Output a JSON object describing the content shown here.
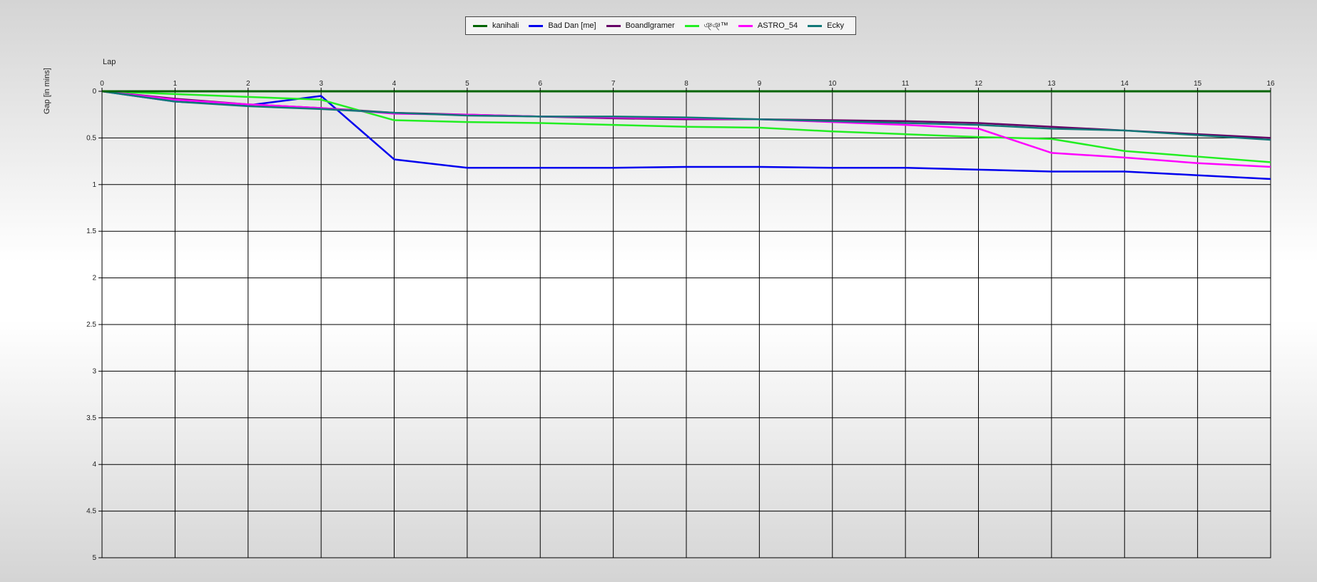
{
  "chart_data": {
    "type": "line",
    "xlabel": "Lap",
    "ylabel": "Gap [in mins]",
    "xlim": [
      0,
      16
    ],
    "ylim": [
      0,
      5
    ],
    "y_inverted": true,
    "grid": true,
    "legend": "top-center",
    "x_ticks": [
      "0",
      "1",
      "2",
      "3",
      "4",
      "5",
      "6",
      "7",
      "8",
      "9",
      "10",
      "11",
      "12",
      "13",
      "14",
      "15",
      "16"
    ],
    "y_ticks": [
      {
        "value": 0,
        "label": "0"
      },
      {
        "value": 0.5,
        "label": "0.5"
      },
      {
        "value": 1,
        "label": "1"
      },
      {
        "value": 1.5,
        "label": "1.5"
      },
      {
        "value": 2,
        "label": "2"
      },
      {
        "value": 2.5,
        "label": "2.5"
      },
      {
        "value": 3,
        "label": "3"
      },
      {
        "value": 3.5,
        "label": "3.5"
      },
      {
        "value": 4,
        "label": "4"
      },
      {
        "value": 4.5,
        "label": "4.5"
      },
      {
        "value": 5,
        "label": "5"
      }
    ],
    "x": [
      0,
      1,
      2,
      3,
      4,
      5,
      6,
      7,
      8,
      9,
      10,
      11,
      12,
      13,
      14,
      15,
      16
    ],
    "series": [
      {
        "name": "kanihali",
        "color": "#006400",
        "values": [
          0,
          0,
          0,
          0,
          0,
          0,
          0,
          0,
          0,
          0,
          0,
          0,
          0,
          0,
          0,
          0,
          0
        ]
      },
      {
        "name": "Bad Dan [me]",
        "color": "#0000ee",
        "values": [
          0,
          0.11,
          0.15,
          0.05,
          0.73,
          0.82,
          0.82,
          0.82,
          0.81,
          0.81,
          0.82,
          0.82,
          0.84,
          0.86,
          0.86,
          0.9,
          0.94
        ]
      },
      {
        "name": "Boandlgramer",
        "color": "#660066",
        "values": [
          0,
          0.08,
          0.14,
          0.18,
          0.23,
          0.25,
          0.27,
          0.29,
          0.3,
          0.3,
          0.31,
          0.32,
          0.34,
          0.38,
          0.42,
          0.46,
          0.5
        ]
      },
      {
        "name": "ঞ্ঞ্™",
        "color": "#22ee22",
        "values": [
          0,
          0.03,
          0.06,
          0.09,
          0.31,
          0.33,
          0.34,
          0.36,
          0.38,
          0.39,
          0.43,
          0.46,
          0.49,
          0.51,
          0.64,
          0.7,
          0.76
        ]
      },
      {
        "name": "ASTRO_54",
        "color": "#ff00ff",
        "values": [
          0,
          0.09,
          0.14,
          0.18,
          0.24,
          0.25,
          0.27,
          0.28,
          0.29,
          0.3,
          0.33,
          0.36,
          0.4,
          0.66,
          0.71,
          0.77,
          0.81
        ]
      },
      {
        "name": "Ecky",
        "color": "#117777",
        "values": [
          0,
          0.11,
          0.16,
          0.19,
          0.23,
          0.26,
          0.27,
          0.27,
          0.28,
          0.3,
          0.32,
          0.34,
          0.36,
          0.4,
          0.42,
          0.47,
          0.52
        ]
      }
    ]
  }
}
